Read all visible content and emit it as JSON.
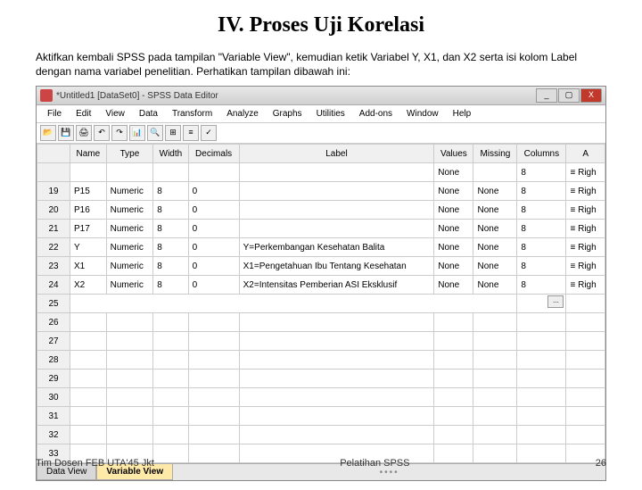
{
  "title": "IV. Proses Uji Korelasi",
  "desc": "Aktifkan kembali SPSS pada tampilan \"Variable View\", kemudian ketik Variabel Y, X1, dan X2 serta isi kolom Label dengan nama variabel penelitian. Perhatikan tampilan dibawah ini:",
  "win": {
    "title": "*Untitled1 [DataSet0] - SPSS Data Editor",
    "min": "_",
    "max": "▢",
    "close": "X"
  },
  "menu": [
    "File",
    "Edit",
    "View",
    "Data",
    "Transform",
    "Analyze",
    "Graphs",
    "Utilities",
    "Add-ons",
    "Window",
    "Help"
  ],
  "cols": [
    "",
    "Name",
    "Type",
    "Width",
    "Decimals",
    "Label",
    "Values",
    "Missing",
    "Columns",
    "A"
  ],
  "rows": [
    {
      "n": "",
      "name": "",
      "type": "",
      "width": "",
      "dec": "",
      "label": "",
      "val": "None",
      "miss": "",
      "colw": "8",
      "al": "≡ Righ"
    },
    {
      "n": "19",
      "name": "P15",
      "type": "Numeric",
      "width": "8",
      "dec": "0",
      "label": "",
      "val": "None",
      "miss": "None",
      "colw": "8",
      "al": "≡ Righ"
    },
    {
      "n": "20",
      "name": "P16",
      "type": "Numeric",
      "width": "8",
      "dec": "0",
      "label": "",
      "val": "None",
      "miss": "None",
      "colw": "8",
      "al": "≡ Righ"
    },
    {
      "n": "21",
      "name": "P17",
      "type": "Numeric",
      "width": "8",
      "dec": "0",
      "label": "",
      "val": "None",
      "miss": "None",
      "colw": "8",
      "al": "≡ Righ"
    },
    {
      "n": "22",
      "name": "Y",
      "type": "Numeric",
      "width": "8",
      "dec": "0",
      "label": "Y=Perkembangan Kesehatan Balita",
      "val": "None",
      "miss": "None",
      "colw": "8",
      "al": "≡ Righ"
    },
    {
      "n": "23",
      "name": "X1",
      "type": "Numeric",
      "width": "8",
      "dec": "0",
      "label": "X1=Pengetahuan Ibu Tentang Kesehatan",
      "val": "None",
      "miss": "None",
      "colw": "8",
      "al": "≡ Righ"
    },
    {
      "n": "24",
      "name": "X2",
      "type": "Numeric",
      "width": "8",
      "dec": "0",
      "label": "X2=Intensitas Pemberian ASI Eksklusif",
      "val": "None",
      "miss": "None",
      "colw": "8",
      "al": "≡ Righ"
    },
    {
      "n": "25"
    },
    {
      "n": "26"
    },
    {
      "n": "27"
    },
    {
      "n": "28"
    },
    {
      "n": "29"
    },
    {
      "n": "30"
    },
    {
      "n": "31"
    },
    {
      "n": "32"
    },
    {
      "n": "33"
    }
  ],
  "tabs": {
    "data": "Data View",
    "var": "Variable View"
  },
  "selbtn": "...",
  "footer": {
    "left": "Tim Dosen FEB UTA'45 Jkt",
    "center": "Pelatihan SPSS",
    "right": "26"
  }
}
